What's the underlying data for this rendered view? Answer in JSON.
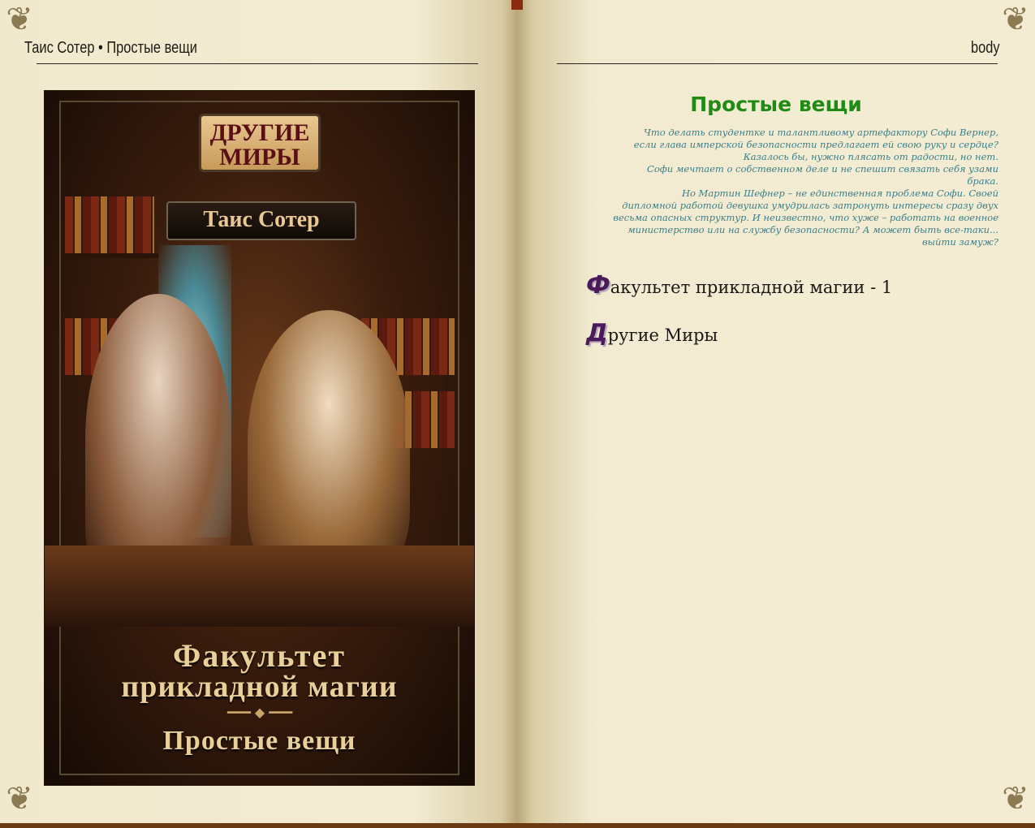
{
  "header": {
    "left_author": "Таис Сотер",
    "left_sep": "•",
    "left_title": "Простые вещи",
    "right_label": "body"
  },
  "cover": {
    "series_text": "ДРУГИЕ МИРЫ",
    "author": "Таис Сотер",
    "title_line1": "Факультет",
    "title_line2": "прикладной магии",
    "title_line3": "Простые вещи"
  },
  "right_page": {
    "title": "Простые вещи",
    "annotation": [
      "Что делать студентке и талантливому артефактору Софи Вернер,",
      "если глава имперской безопасности предлагает ей свою руку и сердце?",
      "Казалось бы, нужно плясать от радости, но нет.",
      "Софи мечтает о собственном деле и не спешит связать себя узами",
      "брака.",
      "Но Мартин Шефнер – не единственная проблема Софи. Своей",
      "дипломной работой девушка умудрилась затронуть интересы сразу двух",
      "весьма опасных структур. И неизвестно, что хуже – работать на военное",
      "министерство или на службу безопасности? А может быть все-таки...",
      "выйти замуж?"
    ],
    "entries": [
      {
        "cap": "Ф",
        "rest": "акультет прикладной магии - 1"
      },
      {
        "cap": "Д",
        "rest": "ругие Миры"
      }
    ]
  },
  "colors": {
    "title_green": "#1f8a14",
    "annotation_teal": "#3a7f8a",
    "dropcap_purple": "#4a1a5a",
    "page_bg": "#f3ecd3"
  }
}
